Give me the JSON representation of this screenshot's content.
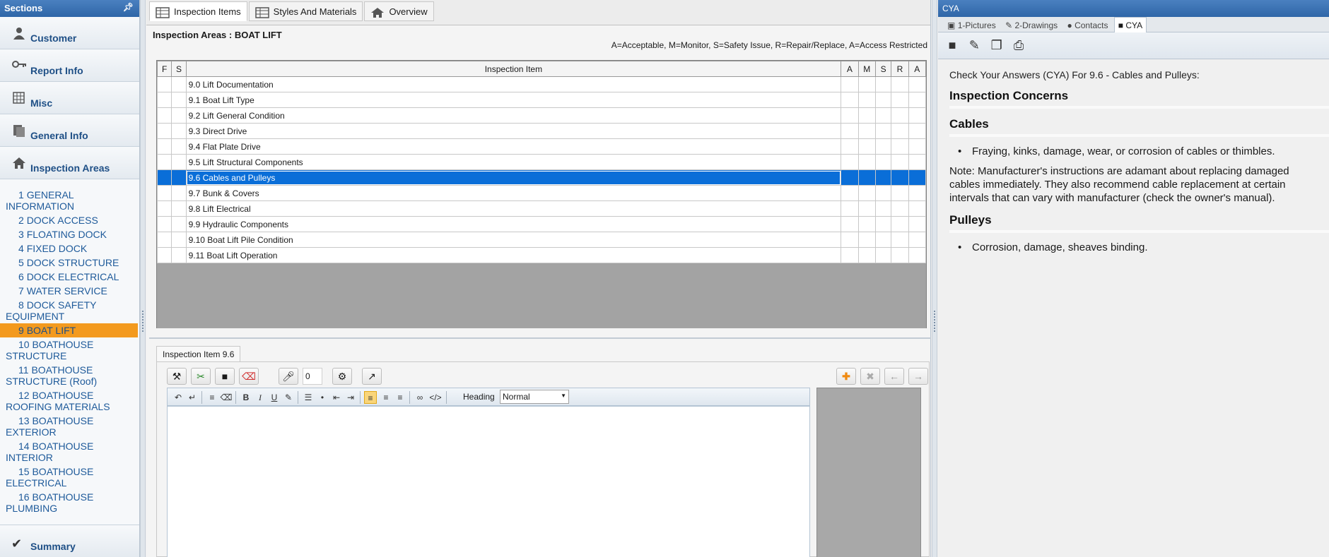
{
  "sidebar": {
    "title": "Sections",
    "sections": [
      {
        "label": "Customer",
        "icon": "person-icon"
      },
      {
        "label": "Report Info",
        "icon": "key-icon"
      },
      {
        "label": "Misc",
        "icon": "grid-icon"
      },
      {
        "label": "General Info",
        "icon": "document-icon"
      },
      {
        "label": "Inspection Areas",
        "icon": "house-icon"
      }
    ],
    "areas": [
      {
        "num": "1",
        "text": "GENERAL INFORMATION"
      },
      {
        "num": "2",
        "text": "DOCK ACCESS"
      },
      {
        "num": "3",
        "text": "FLOATING DOCK"
      },
      {
        "num": "4",
        "text": "FIXED DOCK"
      },
      {
        "num": "5",
        "text": "DOCK STRUCTURE"
      },
      {
        "num": "6",
        "text": "DOCK ELECTRICAL"
      },
      {
        "num": "7",
        "text": "WATER SERVICE"
      },
      {
        "num": "8",
        "text": "DOCK SAFETY EQUIPMENT"
      },
      {
        "num": "9",
        "text": "BOAT LIFT"
      },
      {
        "num": "10",
        "text": "BOATHOUSE STRUCTURE"
      },
      {
        "num": "11",
        "text": "BOATHOUSE STRUCTURE (Roof)"
      },
      {
        "num": "12",
        "text": "BOATHOUSE ROOFING MATERIALS"
      },
      {
        "num": "13",
        "text": "BOATHOUSE EXTERIOR"
      },
      {
        "num": "14",
        "text": "BOATHOUSE INTERIOR"
      },
      {
        "num": "15",
        "text": "BOATHOUSE ELECTRICAL"
      },
      {
        "num": "16",
        "text": "BOATHOUSE PLUMBING"
      }
    ],
    "selected_area": 8,
    "summary_label": "Summary"
  },
  "main": {
    "tabs": [
      {
        "label": "Inspection Items",
        "icon": "table-icon"
      },
      {
        "label": "Styles And Materials",
        "icon": "table-icon"
      },
      {
        "label": "Overview",
        "icon": "house-icon"
      }
    ],
    "area_title": "Inspection Areas : BOAT LIFT",
    "legend": "A=Acceptable, M=Monitor, S=Safety Issue, R=Repair/Replace, A=Access Restricted",
    "columns": [
      "F",
      "S",
      "Inspection Item",
      "A",
      "M",
      "S",
      "R",
      "A"
    ],
    "items": [
      "9.0 Lift Documentation",
      "9.1 Boat Lift Type",
      "9.2 Lift General Condition",
      "9.3 Direct Drive",
      "9.4 Flat Plate Drive",
      "9.5 Lift Structural Components",
      "9.6 Cables and Pulleys",
      "9.7 Bunk & Covers",
      "9.8 Lift Electrical",
      "9.9 Hydraulic Components",
      "9.10 Boat Lift Pile Condition",
      "9.11 Boat Lift Operation"
    ],
    "selected_item": 6,
    "editor": {
      "tab_label": "Inspection Item 9.6",
      "counter": "0",
      "heading_label": "Heading",
      "heading_value": "Normal"
    }
  },
  "cya": {
    "header": "CYA",
    "tabs": [
      {
        "label": "1-Pictures",
        "icon": "camera-icon"
      },
      {
        "label": "2-Drawings",
        "icon": "pencil-icon"
      },
      {
        "label": "Contacts",
        "icon": "person-icon"
      },
      {
        "label": "CYA",
        "icon": "book-icon"
      }
    ],
    "intro": "Check Your Answers (CYA) For 9.6 - Cables and Pulleys:",
    "heading_main": "Inspection Concerns",
    "heading_cables": "Cables",
    "cables_bullet": "Fraying, kinks, damage, wear, or corrosion of cables or thimbles.",
    "note": "Note: Manufacturer's instructions are adamant about replacing damaged cables immediately. They also recommend cable replacement at certain intervals that can vary with manufacturer (check the owner's manual).",
    "heading_pulleys": "Pulleys",
    "pulleys_bullet": "Corrosion, damage, sheaves binding."
  }
}
